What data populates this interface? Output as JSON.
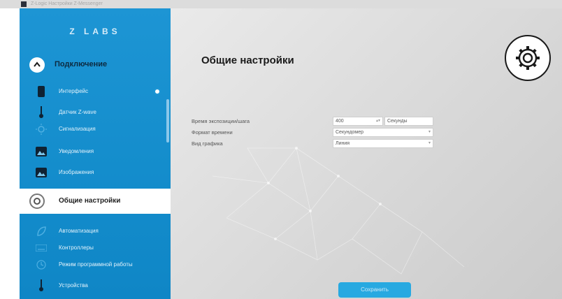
{
  "window": {
    "title": "Z-Logic Настройки Z-Messenger"
  },
  "sidebar": {
    "logo": "Z LABS",
    "connect_label": "Подключение",
    "items": [
      {
        "label": "Интерфейс",
        "icon": "phone-icon"
      },
      {
        "label": "Датчик Z-wave",
        "icon": "thermometer-icon"
      },
      {
        "label": "Сигнализация",
        "icon": "sun-icon"
      },
      {
        "label": "Уведомления",
        "icon": "image-icon"
      },
      {
        "label": "Изображения",
        "icon": "image-icon"
      }
    ],
    "active_item": {
      "label": "Общие настройки",
      "icon": "settings-icon"
    },
    "items_after": [
      {
        "label": "Автоматизация",
        "icon": "leaf-icon"
      },
      {
        "label": "Контроллеры",
        "icon": "keyboard-icon"
      },
      {
        "label": "Режим программной работы",
        "icon": "clock-icon"
      },
      {
        "label": "Устройства",
        "icon": "thermometer-icon"
      }
    ]
  },
  "main": {
    "title": "Общие настройки",
    "fields": [
      {
        "label": "Время экспозиции/шага",
        "value": "400",
        "unit": "Секунды"
      },
      {
        "label": "Формат времени",
        "value": "Секундомер"
      },
      {
        "label": "Вид графика",
        "value": "Линия"
      }
    ],
    "save_label": "Сохранить"
  }
}
